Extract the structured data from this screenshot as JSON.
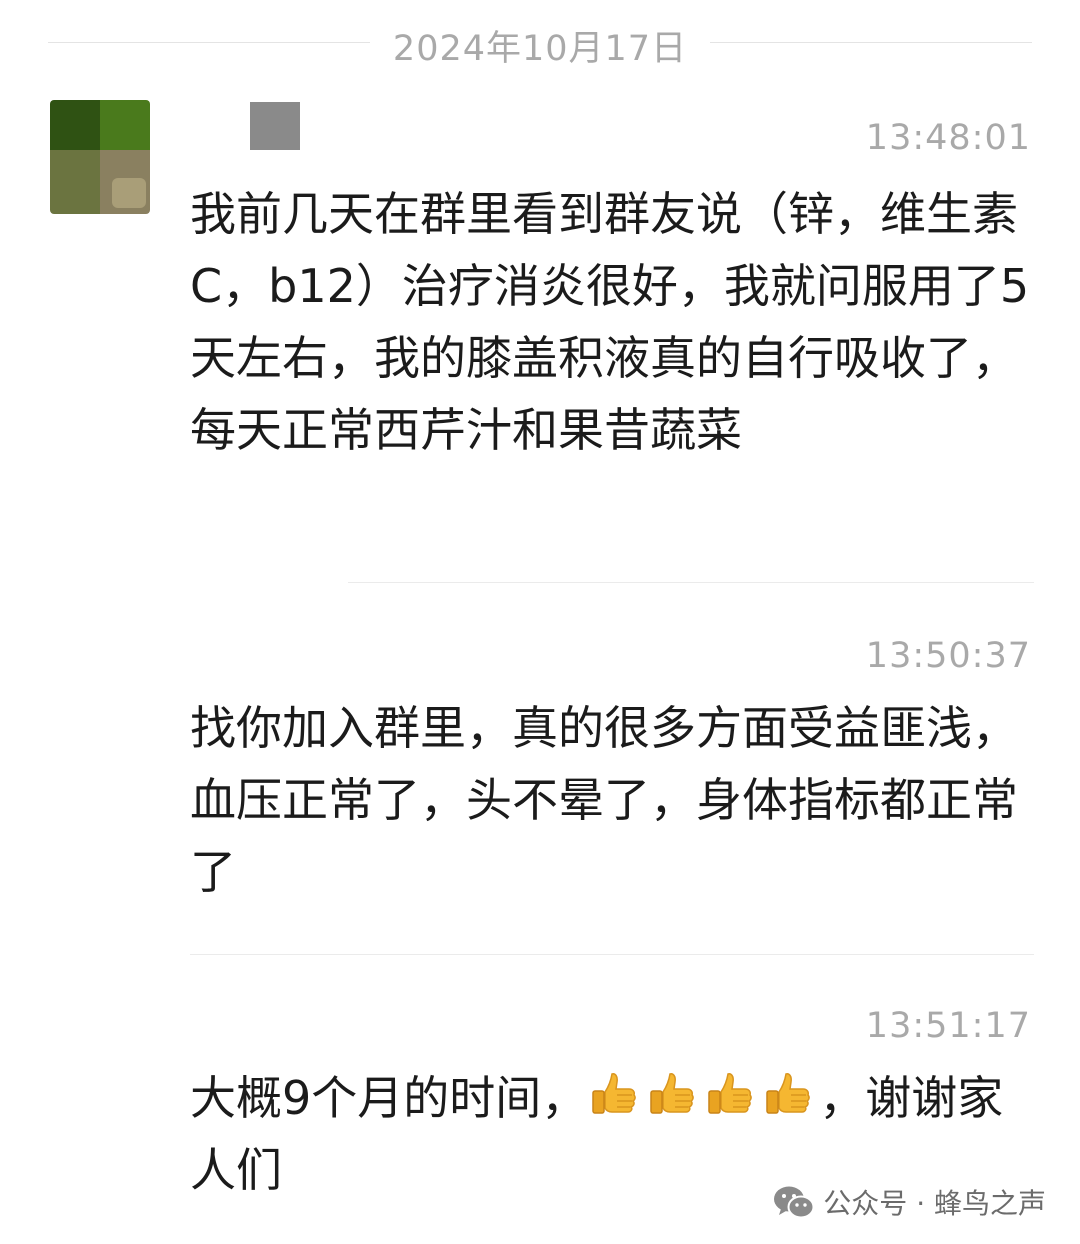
{
  "chat": {
    "date": "2024年10月17日",
    "messages": [
      {
        "time": "13:48:01",
        "text": "我前几天在群里看到群友说（锌，维生素C，b12）治疗消炎很好，我就问服用了5天左右，我的膝盖积液真的自行吸收了，\n每天正常西芹汁和果昔蔬菜"
      },
      {
        "time": "13:50:37",
        "text": "找你加入群里，真的很多方面受益匪浅，血压正常了，头不晕了，身体指标都正常了"
      },
      {
        "time": "13:51:17",
        "text_before": "大概9个月的时间，",
        "emoji_count": 4,
        "emoji_icon": "thumbs-up-icon",
        "text_after": "，谢谢家人们"
      }
    ]
  },
  "watermark": {
    "label": "公众号 · 蜂鸟之声",
    "icon": "wechat-icon"
  }
}
